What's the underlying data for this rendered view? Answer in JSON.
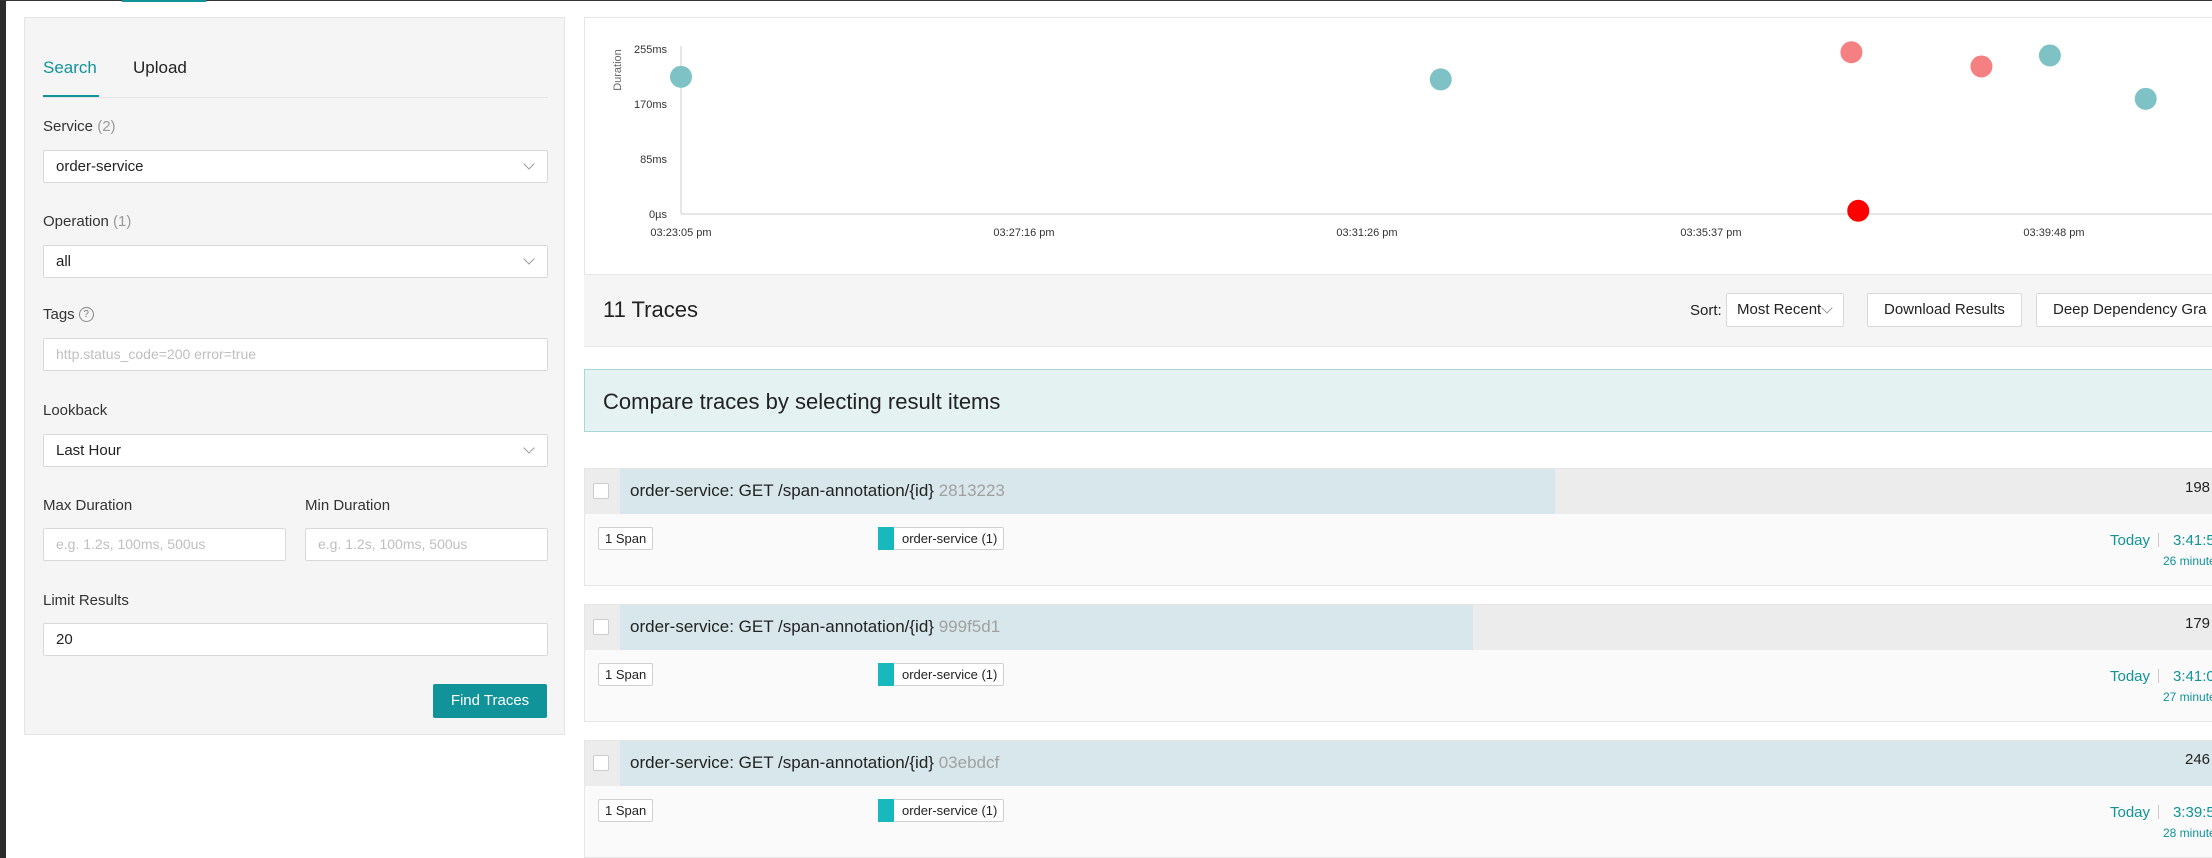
{
  "search": {
    "tabs": [
      {
        "label": "Search",
        "active": true
      },
      {
        "label": "Upload",
        "active": false
      }
    ],
    "service": {
      "label": "Service",
      "count": "(2)",
      "value": "order-service"
    },
    "operation": {
      "label": "Operation",
      "count": "(1)",
      "value": "all"
    },
    "tags": {
      "label": "Tags",
      "help": "?",
      "placeholder": "http.status_code=200 error=true"
    },
    "lookback": {
      "label": "Lookback",
      "value": "Last Hour"
    },
    "max_duration": {
      "label": "Max Duration",
      "placeholder": "e.g. 1.2s, 100ms, 500us"
    },
    "min_duration": {
      "label": "Min Duration",
      "placeholder": "e.g. 1.2s, 100ms, 500us"
    },
    "limit": {
      "label": "Limit Results",
      "value": "20"
    },
    "find_button": "Find Traces"
  },
  "chart_data": {
    "type": "scatter",
    "ylabel": "Duration",
    "y_ticks": [
      "0µs",
      "85ms",
      "170ms",
      "255ms"
    ],
    "x_ticks": [
      "03:23:05 pm",
      "03:27:16 pm",
      "03:31:26 pm",
      "03:35:37 pm",
      "03:39:48 pm"
    ],
    "ylim": [
      0,
      255
    ],
    "series": [
      {
        "points": [
          {
            "x": "03:23:05 pm",
            "y": 212,
            "status": "ok"
          },
          {
            "x": "03:32:20 pm",
            "y": 208,
            "status": "ok"
          },
          {
            "x": "03:37:20 pm",
            "y": 250,
            "status": "error-partial"
          },
          {
            "x": "03:37:25 pm",
            "y": 5,
            "status": "error"
          },
          {
            "x": "03:38:55 pm",
            "y": 228,
            "status": "error-partial"
          },
          {
            "x": "03:39:45 pm",
            "y": 245,
            "status": "ok"
          },
          {
            "x": "03:40:55 pm",
            "y": 178,
            "status": "ok"
          }
        ]
      }
    ],
    "colors": {
      "ok": "#7fc2c5",
      "error-partial": "#f58082",
      "error": "#ff0000"
    },
    "grid": false
  },
  "results": {
    "count_label": "11 Traces",
    "sort_label": "Sort:",
    "sort_value": "Most Recent",
    "download_label": "Download Results",
    "deep_label": "Deep Dependency Gra"
  },
  "compare_banner": "Compare traces by selecting result items",
  "traces": [
    {
      "service_op": "order-service: GET /span-annotation/{id}",
      "id": "2813223",
      "duration": "198",
      "spans": "1 Span",
      "service_tag": "order-service (1)",
      "day": "Today",
      "time": "3:41:5",
      "ago": "26 minute",
      "bar_pct": 0.57
    },
    {
      "service_op": "order-service: GET /span-annotation/{id}",
      "id": "999f5d1",
      "duration": "179",
      "spans": "1 Span",
      "service_tag": "order-service (1)",
      "day": "Today",
      "time": "3:41:0",
      "ago": "27 minute",
      "bar_pct": 0.52
    },
    {
      "service_op": "order-service: GET /span-annotation/{id}",
      "id": "03ebdcf",
      "duration": "246",
      "spans": "1 Span",
      "service_tag": "order-service (1)",
      "day": "Today",
      "time": "3:39:5",
      "ago": "28 minute",
      "bar_pct": 1.0
    }
  ]
}
